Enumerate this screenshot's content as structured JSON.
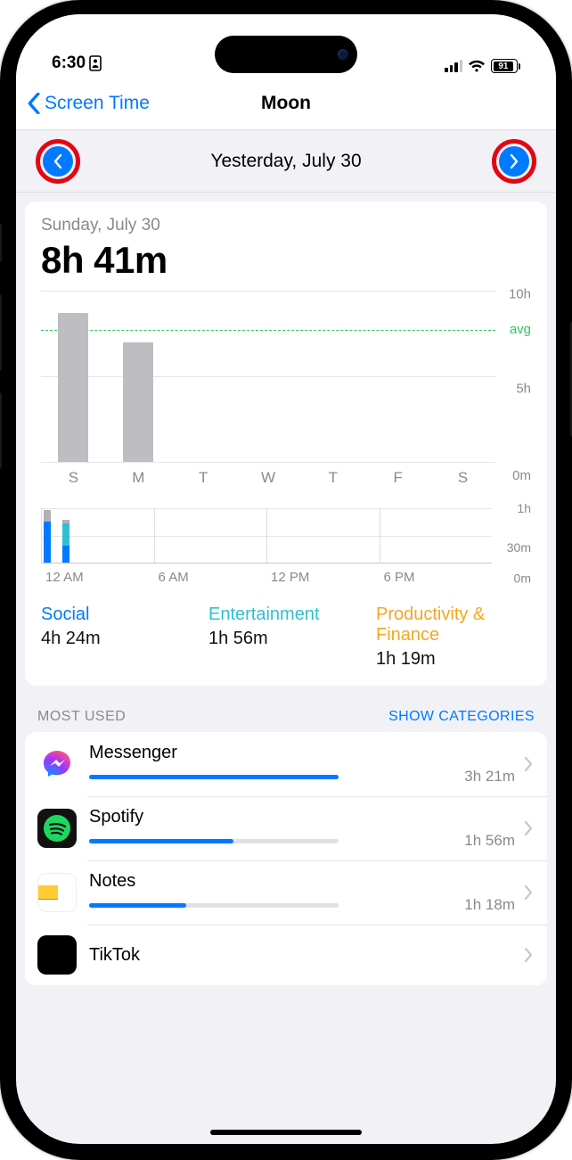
{
  "status": {
    "time": "6:30",
    "battery_pct": "91"
  },
  "nav": {
    "back": "Screen Time",
    "title": "Moon"
  },
  "picker": {
    "label": "Yesterday, July 30"
  },
  "summary": {
    "day_label": "Sunday, July 30",
    "total": "8h 41m"
  },
  "chart_data": [
    {
      "type": "bar",
      "categories": [
        "S",
        "M",
        "T",
        "W",
        "T",
        "F",
        "S"
      ],
      "values": [
        8.7,
        7.0,
        0,
        0,
        0,
        0,
        0
      ],
      "ylim": [
        0,
        10
      ],
      "y_ticks": [
        0,
        5,
        10
      ],
      "y_tick_labels": [
        "0m",
        "5h",
        "10h"
      ],
      "avg": 8.0,
      "avg_label": "avg",
      "ylabel": "",
      "xlabel": ""
    },
    {
      "type": "bar",
      "categories": [
        "12 AM",
        "6 AM",
        "12 PM",
        "6 PM"
      ],
      "x_hours": [
        0,
        1,
        2,
        3,
        4,
        5,
        6,
        7,
        8,
        9,
        10,
        11,
        12,
        13,
        14,
        15,
        16,
        17,
        18,
        19,
        20,
        21,
        22,
        23
      ],
      "series": [
        {
          "name": "Social",
          "color": "#007aff",
          "values": [
            45,
            18,
            0,
            0,
            0,
            0,
            0,
            0,
            0,
            0,
            0,
            0,
            0,
            0,
            0,
            0,
            0,
            0,
            0,
            0,
            0,
            0,
            0,
            0
          ]
        },
        {
          "name": "Entertainment",
          "color": "#2fc0d0",
          "values": [
            0,
            25,
            0,
            0,
            0,
            0,
            0,
            0,
            0,
            0,
            0,
            0,
            0,
            0,
            0,
            0,
            0,
            0,
            0,
            0,
            0,
            0,
            0,
            0
          ]
        },
        {
          "name": "Other",
          "color": "#b0b0b5",
          "values": [
            12,
            3,
            0,
            0,
            0,
            0,
            0,
            0,
            0,
            0,
            0,
            0,
            0,
            0,
            0,
            0,
            0,
            0,
            0,
            0,
            0,
            0,
            0,
            0
          ]
        }
      ],
      "ylim": [
        0,
        60
      ],
      "y_ticks": [
        0,
        30,
        60
      ],
      "y_tick_labels": [
        "0m",
        "30m",
        "1h"
      ]
    }
  ],
  "categories": [
    {
      "name": "Social",
      "color": "#007aff",
      "value": "4h 24m"
    },
    {
      "name": "Entertainment",
      "color": "#2fc0d0",
      "value": "1h 56m"
    },
    {
      "name": "Productivity & Finance",
      "color": "#f5a623",
      "value": "1h 19m"
    }
  ],
  "most_used": {
    "header": "MOST USED",
    "action": "SHOW CATEGORIES",
    "max_minutes": 201,
    "items": [
      {
        "name": "Messenger",
        "time": "3h 21m",
        "minutes": 201,
        "color": "#007aff",
        "icon": "messenger"
      },
      {
        "name": "Spotify",
        "time": "1h 56m",
        "minutes": 116,
        "color": "#007aff",
        "icon": "spotify"
      },
      {
        "name": "Notes",
        "time": "1h 18m",
        "minutes": 78,
        "color": "#007aff",
        "icon": "notes"
      },
      {
        "name": "TikTok",
        "time": "",
        "minutes": 0,
        "color": "#007aff",
        "icon": "tiktok"
      }
    ]
  }
}
